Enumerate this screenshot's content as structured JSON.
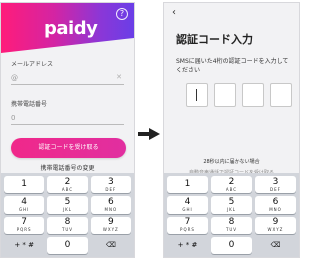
{
  "left": {
    "logo": "paidy",
    "help_icon": "?",
    "email_label": "メールアドレス",
    "email_value": "@",
    "phone_label": "携帯電話番号",
    "phone_value": "0",
    "cta_label": "認証コードを受け取る",
    "change_link": "携帯電話番号の変更"
  },
  "right": {
    "back_icon": "‹",
    "title": "認証コード入力",
    "instruction": "SMSに届いた4桁の認証コードを入力してください",
    "not_received": "28秒以内に届かない場合",
    "auto_call": "自動音声通話で認証コードを受け取る"
  },
  "keypad": [
    {
      "num": "1",
      "sub": ""
    },
    {
      "num": "2",
      "sub": "ABC"
    },
    {
      "num": "3",
      "sub": "DEF"
    },
    {
      "num": "4",
      "sub": "GHI"
    },
    {
      "num": "5",
      "sub": "JKL"
    },
    {
      "num": "6",
      "sub": "MNO"
    },
    {
      "num": "7",
      "sub": "PQRS"
    },
    {
      "num": "8",
      "sub": "TUV"
    },
    {
      "num": "9",
      "sub": "WXYZ"
    },
    {
      "num": "+ * #",
      "sub": ""
    },
    {
      "num": "0",
      "sub": ""
    },
    {
      "num": "⌫",
      "sub": ""
    }
  ],
  "colors": {
    "brand_pink": "#f0288a",
    "brand_purple": "#6a3ee7"
  },
  "icons": {
    "help": "help-icon",
    "back": "back-icon",
    "arrow": "arrow-right-icon",
    "backspace": "backspace-icon"
  }
}
